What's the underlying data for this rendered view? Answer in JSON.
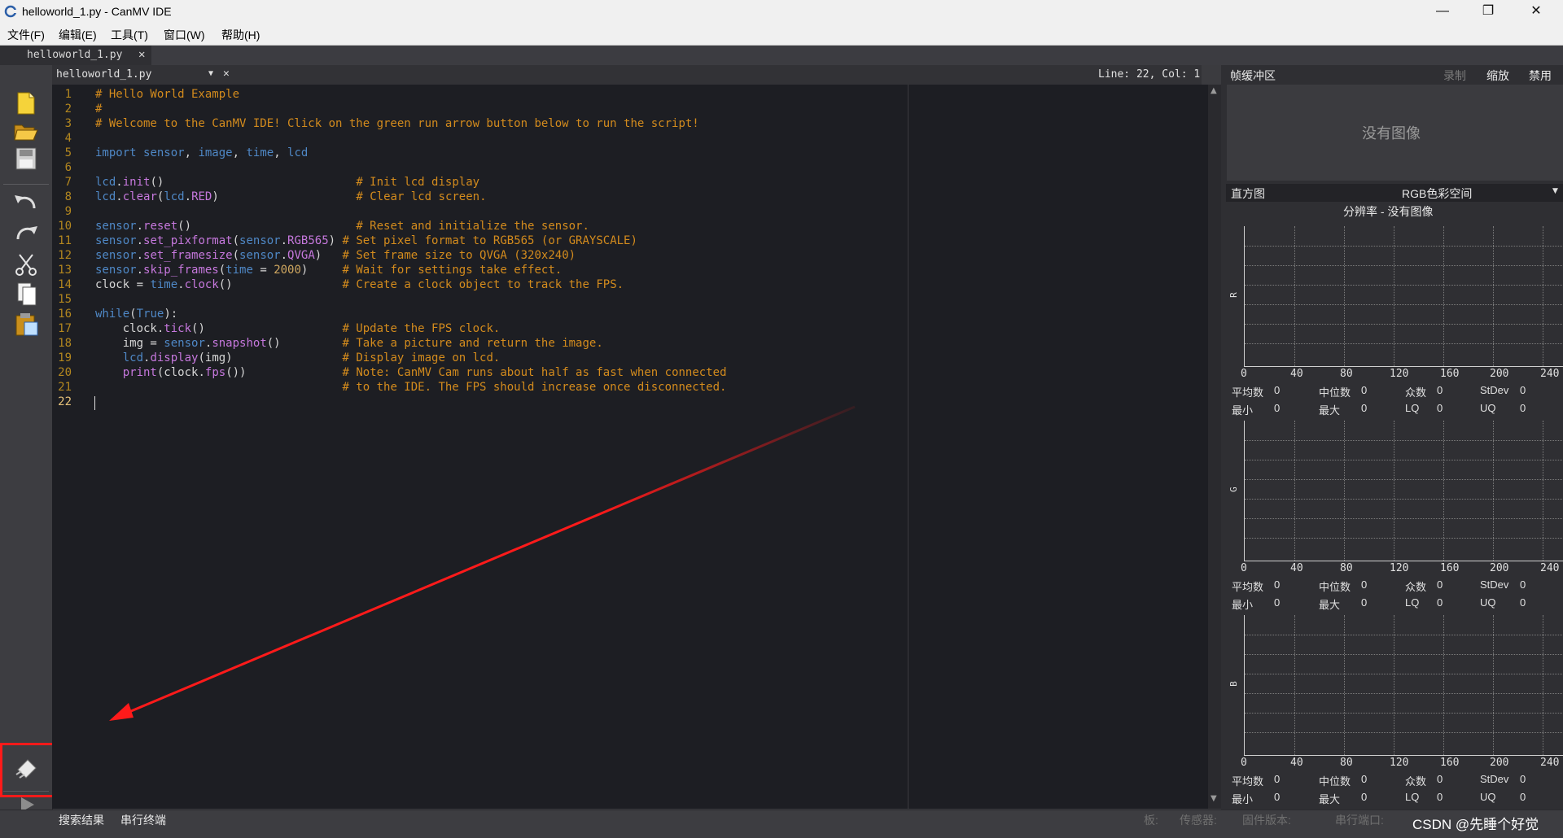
{
  "window": {
    "title": "helloworld_1.py - CanMV IDE",
    "minimize": "—",
    "restore": "❐",
    "close": "✕"
  },
  "menu": [
    "文件(F)",
    "编辑(E)",
    "工具(T)",
    "窗口(W)",
    "帮助(H)"
  ],
  "tab": {
    "name": "helloworld_1.py",
    "close": "✕"
  },
  "editor": {
    "file": "helloworld_1.py",
    "position": "Line: 22, Col: 1",
    "lines": [
      "# Hello World Example",
      "#",
      "# Welcome to the CanMV IDE! Click on the green run arrow button below to run the script!",
      "",
      "import sensor, image, time, lcd",
      "",
      "lcd.init()                            # Init lcd display",
      "lcd.clear(lcd.RED)                    # Clear lcd screen.",
      "",
      "sensor.reset()                        # Reset and initialize the sensor.",
      "sensor.set_pixformat(sensor.RGB565) # Set pixel format to RGB565 (or GRAYSCALE)",
      "sensor.set_framesize(sensor.QVGA)   # Set frame size to QVGA (320x240)",
      "sensor.skip_frames(time = 2000)     # Wait for settings take effect.",
      "clock = time.clock()                # Create a clock object to track the FPS.",
      "",
      "while(True):",
      "    clock.tick()                    # Update the FPS clock.",
      "    img = sensor.snapshot()         # Take a picture and return the image.",
      "    lcd.display(img)                # Display image on lcd.",
      "    print(clock.fps())              # Note: CanMV Cam runs about half as fast when connected",
      "                                    # to the IDE. The FPS should increase once disconnected.",
      ""
    ]
  },
  "frame_buffer": {
    "title": "帧缓冲区",
    "record": "录制",
    "zoom": "缩放",
    "disable": "禁用",
    "no_image": "没有图像"
  },
  "histogram": {
    "title": "直方图",
    "color_space": "RGB色彩空间",
    "resolution": "分辨率 - 没有图像",
    "channels": [
      "R",
      "G",
      "B"
    ],
    "ticks": [
      "0",
      "40",
      "80",
      "120",
      "160",
      "200",
      "240"
    ],
    "stats_row1": [
      "平均数",
      "0",
      "中位数",
      "0",
      "众数",
      "0",
      "StDev",
      "0"
    ],
    "stats_row2": [
      "最小",
      "0",
      "最大",
      "0",
      "LQ",
      "0",
      "UQ",
      "0"
    ]
  },
  "bottom": {
    "search_results": "搜索结果",
    "serial_terminal": "串行终端",
    "board": "板:",
    "sensor": "传感器:",
    "firmware": "固件版本:",
    "serial_port": "串行端口:",
    "watermark": "CSDN @先睡个好觉"
  },
  "colors": {
    "annotation": "#ff1a1a",
    "comment": "#d38b1d",
    "keyword": "#4f88c6",
    "function": "#c678dd"
  }
}
